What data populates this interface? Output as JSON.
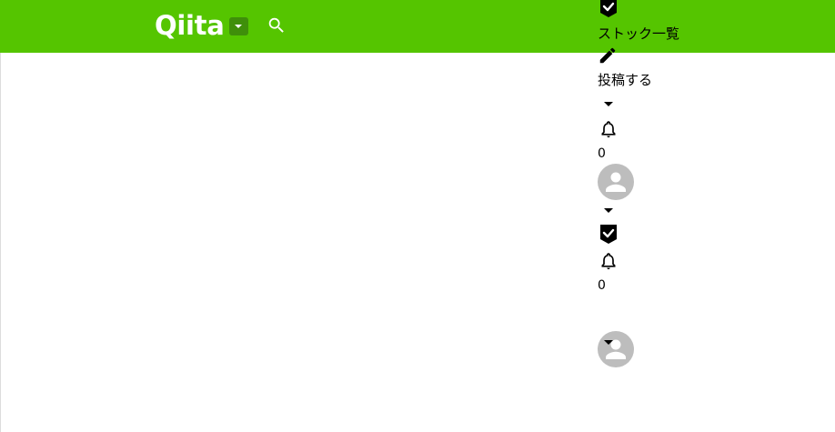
{
  "header": {
    "logo_text": "Qiita",
    "colors": {
      "brand": "#55c500",
      "brand_dark": "#3f8f0a"
    },
    "icons": {
      "logo_dropdown": "caret-down-icon",
      "search": "search-icon"
    }
  },
  "nav": {
    "stock_list_label": "ストック一覧",
    "post_label": "投稿する",
    "notification_count": "0",
    "icons": {
      "stock": "stock-check-icon",
      "post": "pencil-icon",
      "post_menu": "caret-down-icon",
      "notifications": "bell-icon",
      "avatar": "user-avatar",
      "user_menu": "caret-down-icon"
    }
  },
  "nav_compact": {
    "notification_count": "0",
    "icons": {
      "stock": "stock-check-icon",
      "notifications": "bell-icon",
      "avatar": "user-avatar",
      "user_menu": "caret-down-icon"
    }
  }
}
